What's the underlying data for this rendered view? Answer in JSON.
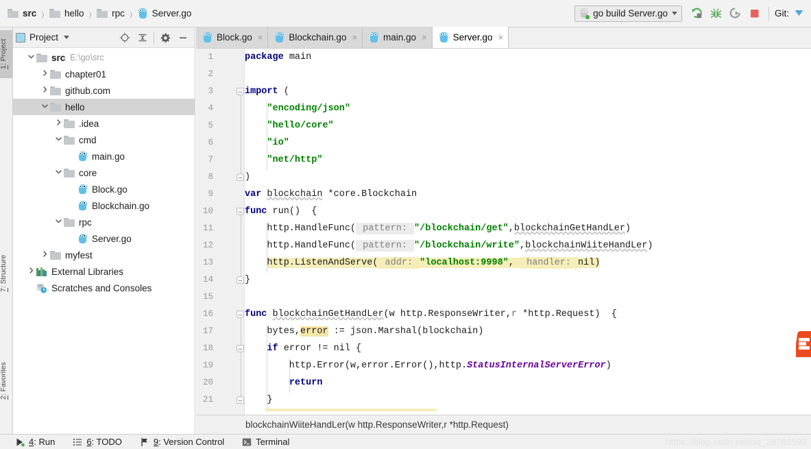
{
  "breadcrumb": {
    "items": [
      {
        "label": "src",
        "icon": "folder-icon",
        "bold": true
      },
      {
        "label": "hello",
        "icon": "folder-icon",
        "bold": false
      },
      {
        "label": "rpc",
        "icon": "folder-icon",
        "bold": false
      },
      {
        "label": "Server.go",
        "icon": "go-file-icon",
        "bold": false
      }
    ],
    "separator": "›"
  },
  "toolbar": {
    "run_config": "go build Server.go",
    "run_tooltip": "Run",
    "debug_tooltip": "Debug",
    "coverage_tooltip": "Run with Coverage",
    "stop_tooltip": "Stop",
    "git_label": "Git:"
  },
  "left_strip": {
    "tabs": [
      {
        "num": "1",
        "label": ": Project",
        "active": true
      },
      {
        "num": "7",
        "label": ": Structure",
        "active": false
      },
      {
        "num": "2",
        "label": ": Favorites",
        "active": false
      }
    ]
  },
  "project_panel": {
    "title": "Project",
    "buttons": [
      "locate-icon",
      "collapse-all-icon",
      "settings-icon",
      "hide-icon"
    ],
    "tree": [
      {
        "depth": 0,
        "arrow": "down",
        "icon": "folder-icon",
        "label": "src",
        "bold": true,
        "path": "E:\\go\\src",
        "selected": false
      },
      {
        "depth": 1,
        "arrow": "right",
        "icon": "folder-icon",
        "label": "chapter01",
        "bold": false,
        "path": "",
        "selected": false
      },
      {
        "depth": 1,
        "arrow": "right",
        "icon": "folder-icon",
        "label": "github.com",
        "bold": false,
        "path": "",
        "selected": false
      },
      {
        "depth": 1,
        "arrow": "down",
        "icon": "folder-icon",
        "label": "hello",
        "bold": false,
        "path": "",
        "selected": true
      },
      {
        "depth": 2,
        "arrow": "right",
        "icon": "folder-icon",
        "label": ".idea",
        "bold": false,
        "path": "",
        "selected": false
      },
      {
        "depth": 2,
        "arrow": "down",
        "icon": "folder-icon",
        "label": "cmd",
        "bold": false,
        "path": "",
        "selected": false
      },
      {
        "depth": 3,
        "arrow": "none",
        "icon": "go-file-icon",
        "label": "main.go",
        "bold": false,
        "path": "",
        "selected": false
      },
      {
        "depth": 2,
        "arrow": "down",
        "icon": "folder-icon",
        "label": "core",
        "bold": false,
        "path": "",
        "selected": false
      },
      {
        "depth": 3,
        "arrow": "none",
        "icon": "go-file-icon",
        "label": "Block.go",
        "bold": false,
        "path": "",
        "selected": false
      },
      {
        "depth": 3,
        "arrow": "none",
        "icon": "go-file-icon",
        "label": "Blockchain.go",
        "bold": false,
        "path": "",
        "selected": false
      },
      {
        "depth": 2,
        "arrow": "down",
        "icon": "folder-icon",
        "label": "rpc",
        "bold": false,
        "path": "",
        "selected": false
      },
      {
        "depth": 3,
        "arrow": "none",
        "icon": "go-file-icon",
        "label": "Server.go",
        "bold": false,
        "path": "",
        "selected": false
      },
      {
        "depth": 1,
        "arrow": "right",
        "icon": "folder-icon",
        "label": "myfest",
        "bold": false,
        "path": "",
        "selected": false
      },
      {
        "depth": 0,
        "arrow": "right",
        "icon": "library-icon",
        "label": "External Libraries",
        "bold": false,
        "path": "",
        "selected": false
      },
      {
        "depth": 0,
        "arrow": "none",
        "icon": "scratches-icon",
        "label": "Scratches and Consoles",
        "bold": false,
        "path": "",
        "selected": false
      }
    ]
  },
  "editor": {
    "tabs": [
      {
        "label": "Block.go",
        "active": false
      },
      {
        "label": "Blockchain.go",
        "active": false
      },
      {
        "label": "main.go",
        "active": false
      },
      {
        "label": "Server.go",
        "active": true
      }
    ],
    "close_glyph": "×",
    "line_numbers": [
      "1",
      "2",
      "3",
      "4",
      "5",
      "6",
      "7",
      "8",
      "9",
      "10",
      "11",
      "12",
      "13",
      "14",
      "15",
      "16",
      "17",
      "18",
      "19",
      "20",
      "21"
    ],
    "breadcrumb_status": "blockchainWiiteHandLer(w http.ResponseWriter,r *http.Request)",
    "code_lines": [
      {
        "n": 1,
        "text": "package main"
      },
      {
        "n": 2,
        "text": ""
      },
      {
        "n": 3,
        "text": "import ("
      },
      {
        "n": 4,
        "text": "    \"encoding/json\""
      },
      {
        "n": 5,
        "text": "    \"hello/core\""
      },
      {
        "n": 6,
        "text": "    \"io\""
      },
      {
        "n": 7,
        "text": "    \"net/http\""
      },
      {
        "n": 8,
        "text": ")"
      },
      {
        "n": 9,
        "text": "var blockchain *core.Blockchain"
      },
      {
        "n": 10,
        "text": "func run()  {"
      },
      {
        "n": 11,
        "text": "    http.HandleFunc( pattern: \"/blockchain/get\",blockchainGetHandLer)"
      },
      {
        "n": 12,
        "text": "    http.HandleFunc( pattern: \"/blockchain/write\",blockchainWiiteHandLer)"
      },
      {
        "n": 13,
        "text": "    http.ListenAndServe( addr: \"localhost:9998\", handler: nil)"
      },
      {
        "n": 14,
        "text": "}"
      },
      {
        "n": 15,
        "text": ""
      },
      {
        "n": 16,
        "text": "func blockchainGetHandLer(w http.ResponseWriter,r *http.Request)  {"
      },
      {
        "n": 17,
        "text": "    bytes,error := json.Marshal(blockchain)"
      },
      {
        "n": 18,
        "text": "    if error != nil {"
      },
      {
        "n": 19,
        "text": "        http.Error(w,error.Error(),http.StatusInternalServerError)"
      },
      {
        "n": 20,
        "text": "        return"
      },
      {
        "n": 21,
        "text": "    }"
      }
    ],
    "parameter_hints": [
      "pattern:",
      "addr:",
      "handler:"
    ],
    "highlighted_tokens": [
      "error",
      "http.ListenAndServe( addr: \"localhost:9998\", handler: nil)"
    ]
  },
  "statusbar": {
    "items": [
      {
        "num": "4",
        "label": ": Run",
        "icon": "run-icon"
      },
      {
        "num": "6",
        "label": ": TODO",
        "icon": "todo-icon"
      },
      {
        "num": "9",
        "label": ": Version Control",
        "icon": "vcs-icon"
      },
      {
        "num": "",
        "label": "Terminal",
        "icon": "terminal-icon"
      }
    ]
  },
  "watermark": "https://blog.csdn.net/qq_28761593",
  "colors": {
    "keyword": "#000080",
    "string": "#008000",
    "field": "#660099",
    "highlight": "#f5eeb8",
    "selection": "#d4d4d4",
    "accent_red": "#e8625c",
    "accent_green": "#4caf50",
    "go_blue": "#5fc0e8",
    "logo_orange": "#ec4a20"
  }
}
